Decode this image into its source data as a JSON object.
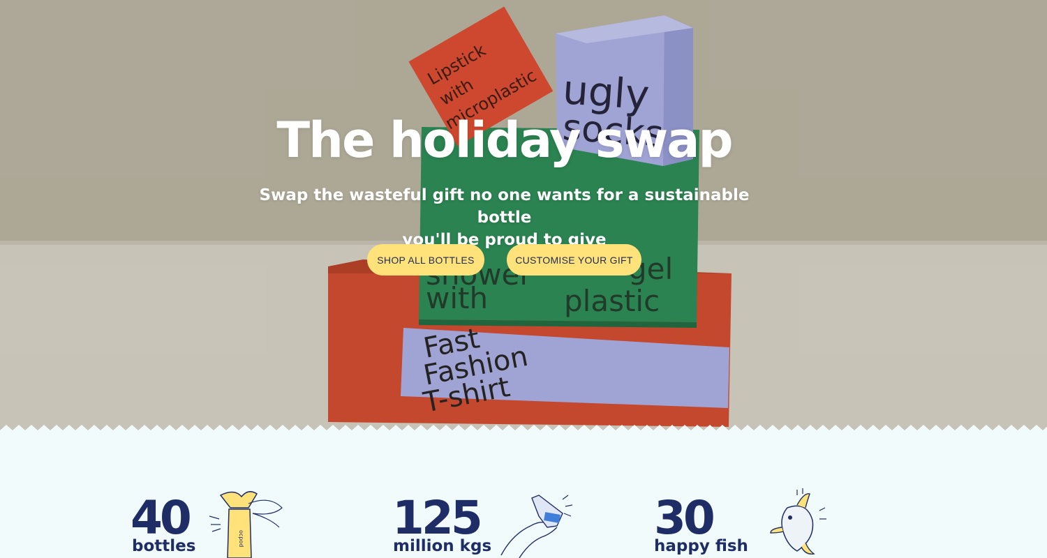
{
  "hero": {
    "title": "The holiday swap",
    "subtitle_line1": "Swap the wasteful gift no one wants for a sustainable bottle",
    "subtitle_line2": "you'll be proud to give",
    "buttons": {
      "shop_all": "SHOP ALL BOTTLES",
      "customise": "CUSTOMISE YOUR GIFT"
    },
    "boxes": {
      "red_top": [
        "Lipstick",
        "with",
        "microplastic"
      ],
      "blue_top": [
        "ugly",
        "socks"
      ],
      "green": [
        "shower",
        "with",
        "gel",
        "plastic"
      ],
      "bottom": [
        "Fast",
        "Fashion",
        "T-shirt"
      ]
    }
  },
  "stats": [
    {
      "number": "40",
      "label": "bottles",
      "icon": "wrapped-bottle-icon"
    },
    {
      "number": "125",
      "label": "million kgs",
      "icon": "crushed-plastic-bottle-icon"
    },
    {
      "number": "30",
      "label": "happy fish",
      "icon": "fish-icon"
    }
  ],
  "colors": {
    "button_bg": "#ffe27a",
    "navy": "#1e2d66",
    "stats_bg": "#f2fbfc",
    "box_red": "#d94a2f",
    "box_green": "#2a8a55",
    "box_lavender": "#a9aee4"
  }
}
